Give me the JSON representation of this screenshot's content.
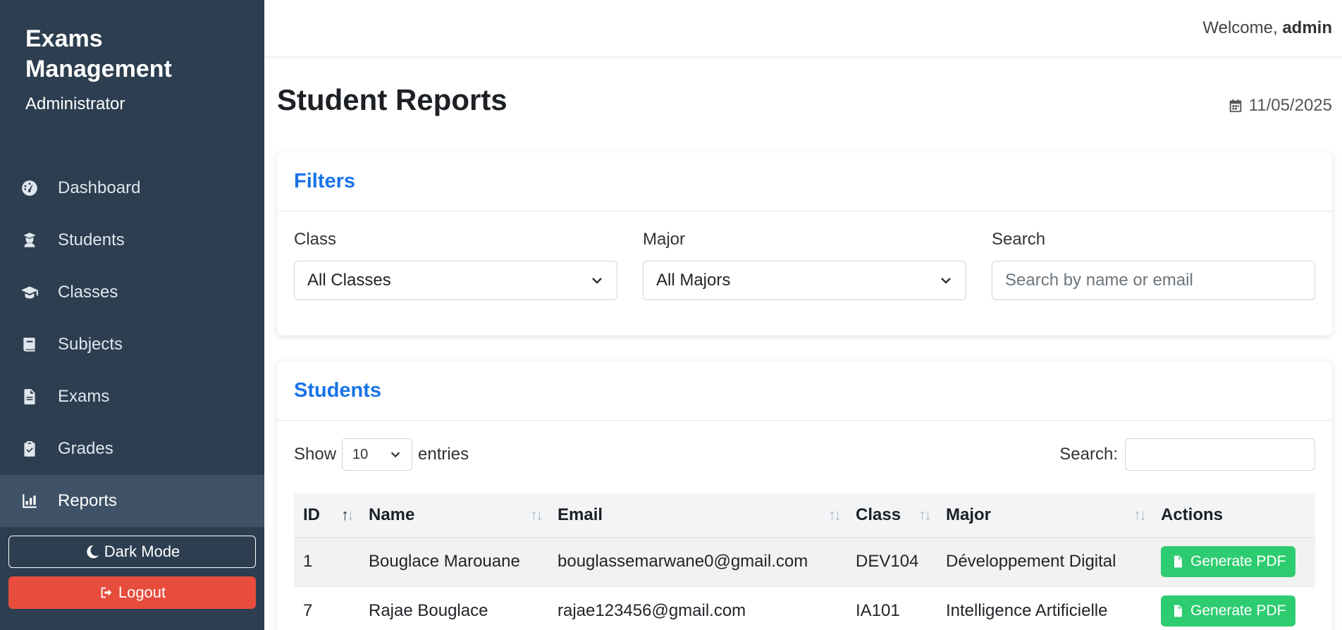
{
  "brand": {
    "title": "Exams Management",
    "role": "Administrator"
  },
  "nav": [
    {
      "label": "Dashboard",
      "icon": "dashboard-icon"
    },
    {
      "label": "Students",
      "icon": "user-graduate-icon"
    },
    {
      "label": "Classes",
      "icon": "graduation-cap-icon"
    },
    {
      "label": "Subjects",
      "icon": "book-icon"
    },
    {
      "label": "Exams",
      "icon": "file-icon"
    },
    {
      "label": "Grades",
      "icon": "clipboard-icon"
    },
    {
      "label": "Reports",
      "icon": "chart-icon",
      "active": true
    }
  ],
  "sidebar_buttons": {
    "dark_mode": "Dark Mode",
    "logout": "Logout"
  },
  "header": {
    "welcome_prefix": "Welcome,",
    "username": "admin"
  },
  "page": {
    "title": "Student Reports",
    "date": "11/05/2025"
  },
  "filters": {
    "title": "Filters",
    "class_label": "Class",
    "class_value": "All Classes",
    "major_label": "Major",
    "major_value": "All Majors",
    "search_label": "Search",
    "search_placeholder": "Search by name or email"
  },
  "students": {
    "title": "Students",
    "show_label": "Show",
    "entries_value": "10",
    "entries_label": "entries",
    "search_label": "Search:",
    "columns": [
      "ID",
      "Name",
      "Email",
      "Class",
      "Major",
      "Actions"
    ],
    "rows": [
      {
        "id": "1",
        "name": "Bouglace Marouane",
        "email": "bouglassemarwane0@gmail.com",
        "class": "DEV104",
        "major": "Développement Digital",
        "action": "Generate PDF"
      },
      {
        "id": "7",
        "name": "Rajae Bouglace",
        "email": "rajae123456@gmail.com",
        "class": "IA101",
        "major": "Intelligence Artificielle",
        "action": "Generate PDF"
      }
    ]
  },
  "colors": {
    "sidebar": "#2c3e50",
    "accent": "#1a73e8",
    "logout": "#e74c3c",
    "pdf": "#2ecc71"
  }
}
